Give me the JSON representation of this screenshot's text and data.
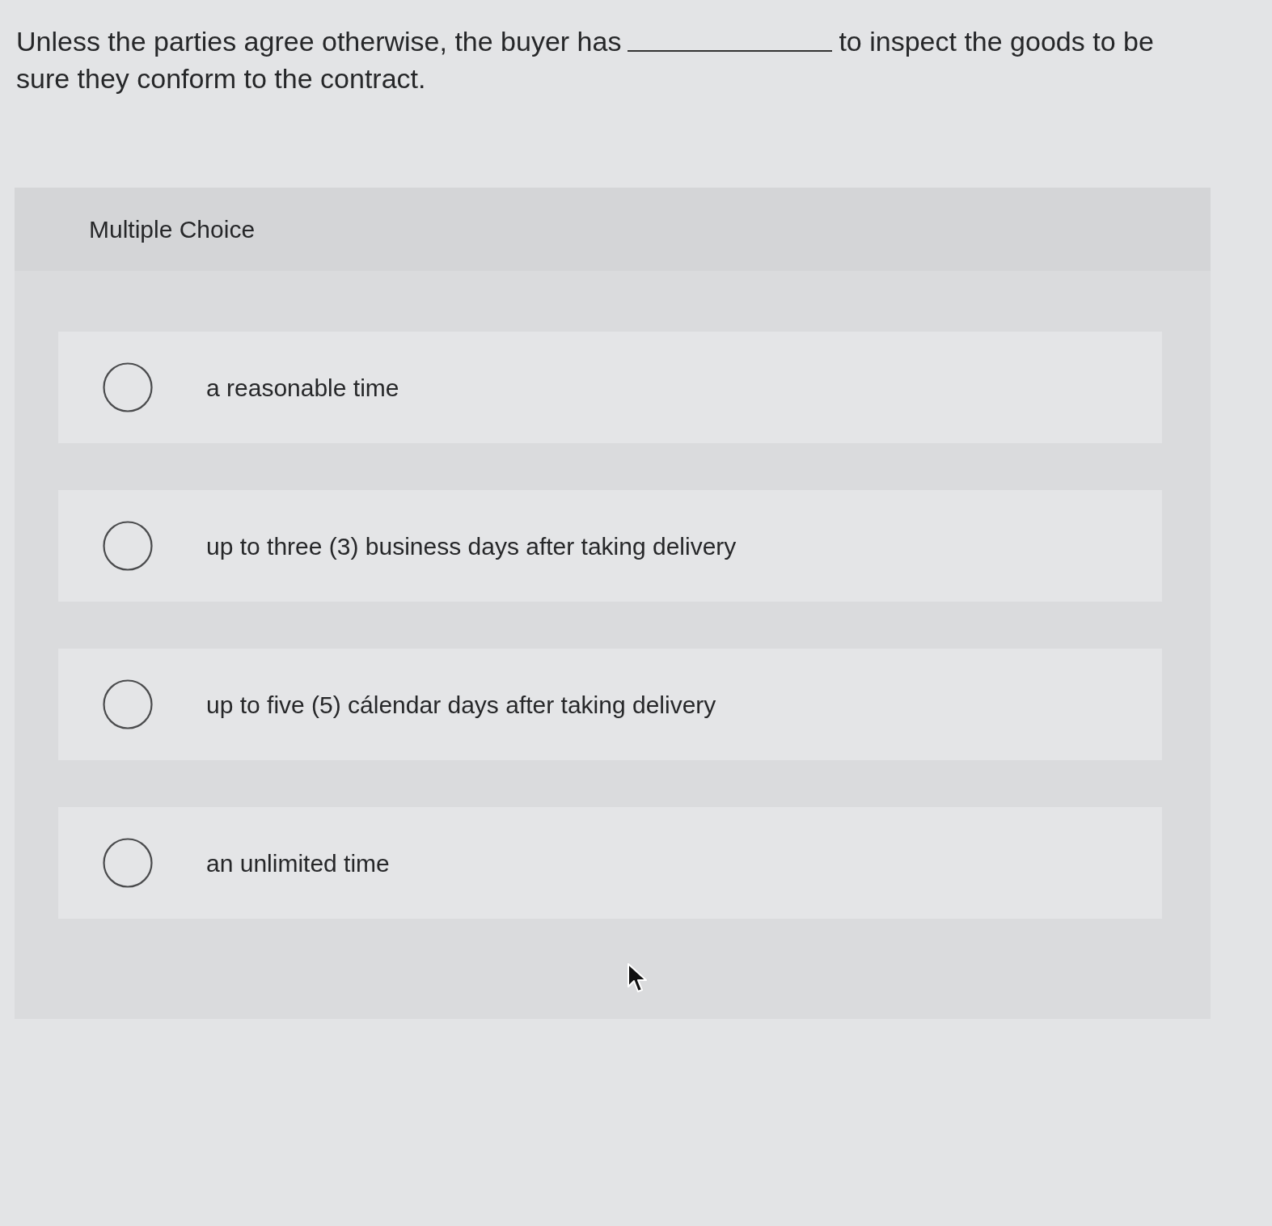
{
  "question": {
    "before": "Unless the parties agree otherwise, the buyer has",
    "after": "to inspect the goods to be",
    "second_line": "sure they conform to the contract."
  },
  "answer_panel": {
    "heading": "Multiple Choice",
    "options": [
      {
        "label": "a reasonable time",
        "selected": false
      },
      {
        "label": "up to three (3) business days after taking delivery",
        "selected": false
      },
      {
        "label": "up to five (5) cálendar days after taking delivery",
        "selected": false
      },
      {
        "label": "an unlimited time",
        "selected": false
      }
    ]
  }
}
